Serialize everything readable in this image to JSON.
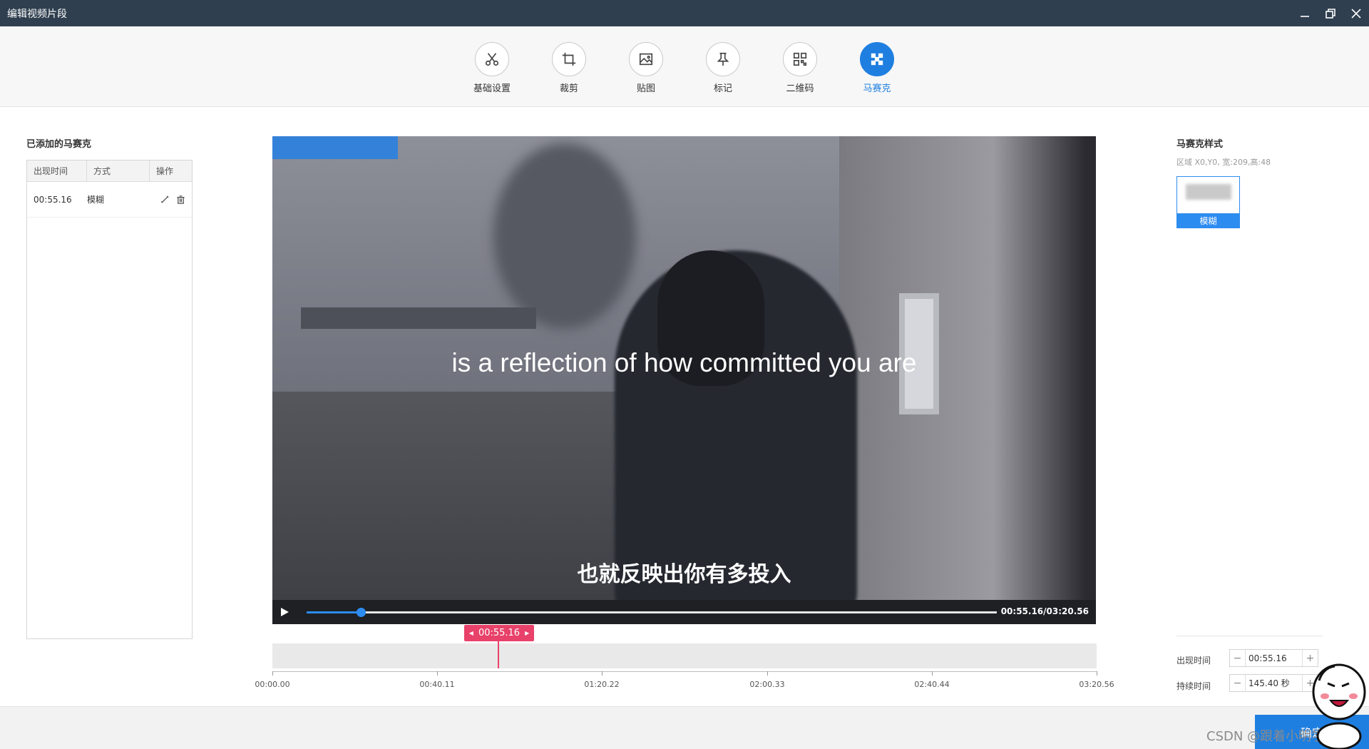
{
  "window": {
    "title": "编辑视频片段"
  },
  "toolbar": {
    "tools": [
      {
        "label": "基础设置",
        "icon": "scissors-icon"
      },
      {
        "label": "裁剪",
        "icon": "crop-icon"
      },
      {
        "label": "贴图",
        "icon": "image-icon"
      },
      {
        "label": "标记",
        "icon": "pin-icon"
      },
      {
        "label": "二维码",
        "icon": "qrcode-icon"
      },
      {
        "label": "马赛克",
        "icon": "mosaic-icon",
        "active": true
      }
    ]
  },
  "left_panel": {
    "title": "已添加的马赛克",
    "columns": [
      "出现时间",
      "方式",
      "操作"
    ],
    "rows": [
      {
        "time": "00:55.16",
        "method": "模糊"
      }
    ]
  },
  "video": {
    "caption_en": "is a reflection of how committed you are",
    "caption_zh": "也就反映出你有多投入",
    "time_display": "00:55.16/03:20.56",
    "progress": 0.078
  },
  "timeline": {
    "marker_time": "00:55.16",
    "ticks": [
      "00:00.00",
      "00:40.11",
      "01:20.22",
      "02:00.33",
      "02:40.44",
      "03:20.56"
    ]
  },
  "right_panel": {
    "title": "马赛克样式",
    "region": "区域 X0,Y0,  宽:209,高:48",
    "style_label": "模糊",
    "appear_label": "出现时间",
    "appear_value": "00:55.16",
    "duration_label": "持续时间",
    "duration_value": "145.40 秒"
  },
  "footer": {
    "ok_label": "确定",
    "watermark": "CSDN @跟着小明学编程"
  },
  "colors": {
    "accent": "#1f7fe0",
    "marker": "#e8416a",
    "titlebar": "#2f3f4f"
  }
}
